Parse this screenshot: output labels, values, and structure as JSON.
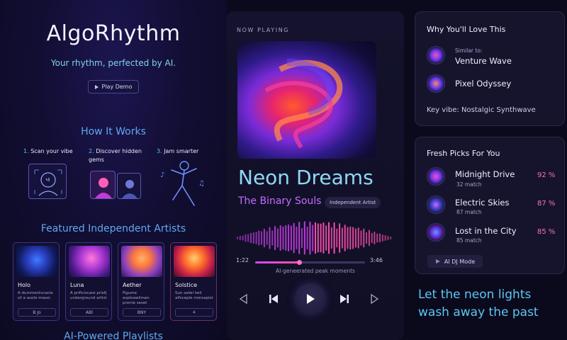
{
  "brand": {
    "name": "AlgoRhythm",
    "tagline": "Your rhythm, perfected by AI.",
    "demo_button": "Play Demo"
  },
  "how_it_works": {
    "title": "How It Works",
    "steps": [
      {
        "num": "1.",
        "label": "Scan your vibe"
      },
      {
        "num": "2.",
        "label": "Discover hidden gems"
      },
      {
        "num": "3.",
        "label": "Jam smarter"
      }
    ]
  },
  "featured": {
    "title": "Featured Independent Artists",
    "artists": [
      {
        "name": "Holo",
        "desc": "A dummentvcacle sil a asolo-massi.",
        "tag": "B Jo"
      },
      {
        "name": "Luna",
        "desc": "A prificiscare priofj underground artist",
        "tag": "ABl"
      },
      {
        "name": "Aether",
        "desc": "Figume esploawlimen pronte seset",
        "tag": "BNY"
      },
      {
        "name": "Solstice",
        "desc": "Sun salwi twil alfsceple rronsapist",
        "tag": "⚘"
      }
    ]
  },
  "next_section_title": "AI-Powered Playlists",
  "player": {
    "label": "NOW PLAYING",
    "title": "Neon Dreams",
    "artist": "The Binary Souls",
    "badge": "Independent Artist",
    "elapsed": "1:22",
    "duration": "3:46",
    "progress": 0.4,
    "caption": "AI-geneerated peak moments"
  },
  "why_love": {
    "title": "Why You'll Love This",
    "similar_label": "Similar to:",
    "items": [
      "Venture Wave",
      "Pixel Odyssey"
    ],
    "key_vibe": "Key vibe: Nostalgic Synthwave"
  },
  "fresh_picks": {
    "title": "Fresh Picks For You",
    "items": [
      {
        "name": "Midnight Drive",
        "match": "32 match",
        "pct": "92 %"
      },
      {
        "name": "Electric Skies",
        "match": "87 match",
        "pct": "87 %"
      },
      {
        "name": "Lost in the City",
        "match": "85 match",
        "pct": "85 %"
      }
    ],
    "dj_button": "AI DJ Mode"
  },
  "quote": "Let the neon lights wash away the past",
  "colors": {
    "accent_cyan": "#5ec6f2",
    "accent_pink": "#f36fc6",
    "accent_purple": "#c46cff"
  }
}
